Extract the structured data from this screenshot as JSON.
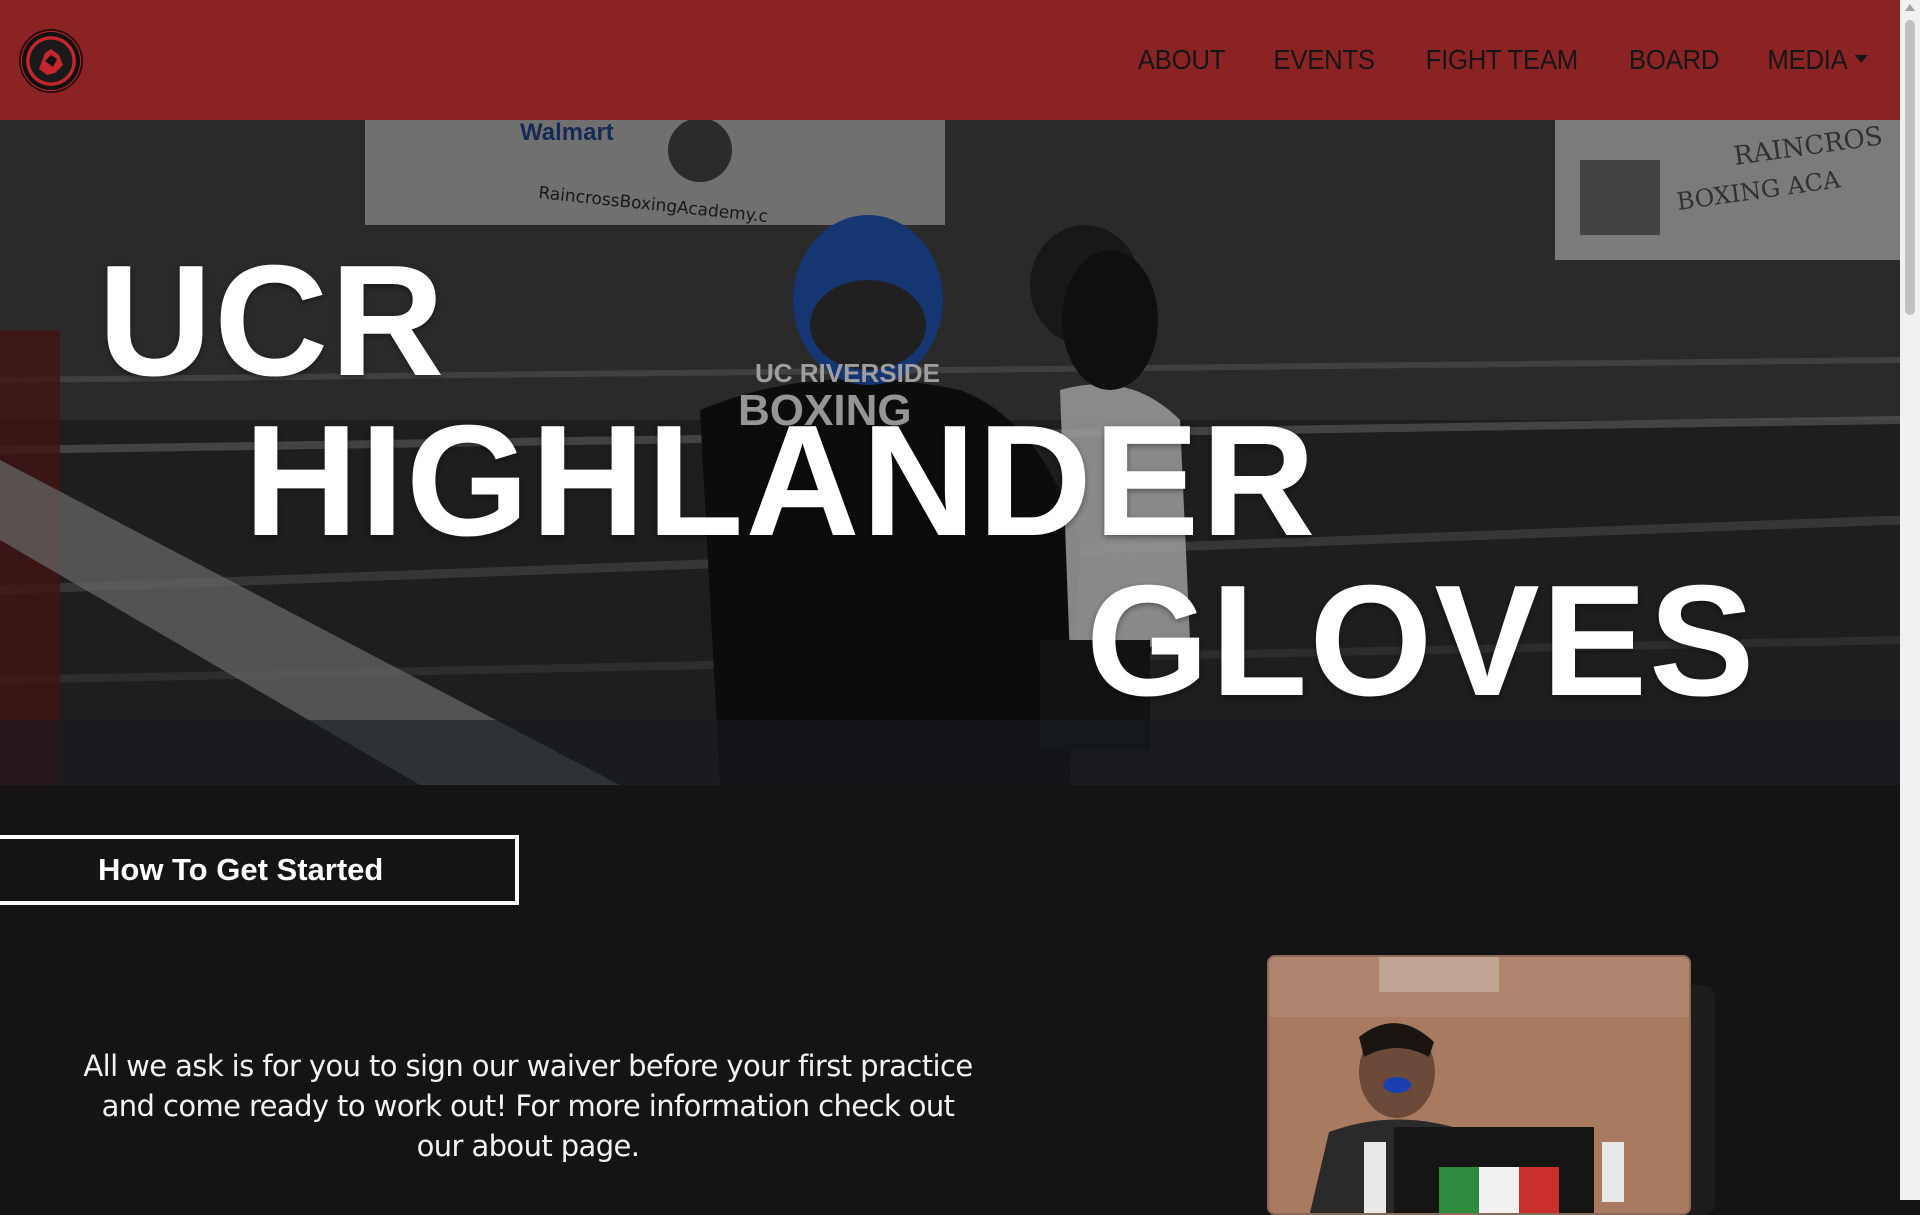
{
  "nav": {
    "logo_icon": "highlander-gloves-logo-icon",
    "items": [
      {
        "label": "ABOUT"
      },
      {
        "label": "EVENTS"
      },
      {
        "label": "FIGHT TEAM"
      },
      {
        "label": "BOARD"
      },
      {
        "label": "MEDIA"
      }
    ],
    "dropdown_icon": "caret-down-icon"
  },
  "hero": {
    "line1": "UCR",
    "line2": "HIGHLANDER",
    "line3": "GLOVES",
    "photo_text": {
      "shirt_top": "UC RIVERSIDE",
      "shirt_bottom": "BOXING",
      "banner_left": "RaincrossBoxingAcademy.c",
      "banner_sponsor": "Walmart",
      "banner_right_1": "RAINCROS",
      "banner_right_2": "BOXING ACA"
    }
  },
  "cta": {
    "label": "How To Get Started"
  },
  "info": {
    "text": "All we ask is for you to sign our waiver before your first practice and come ready to work out! For more information check out our about page."
  },
  "colors": {
    "navbar": "#8b2325",
    "background": "#141414",
    "text": "#ffffff"
  }
}
